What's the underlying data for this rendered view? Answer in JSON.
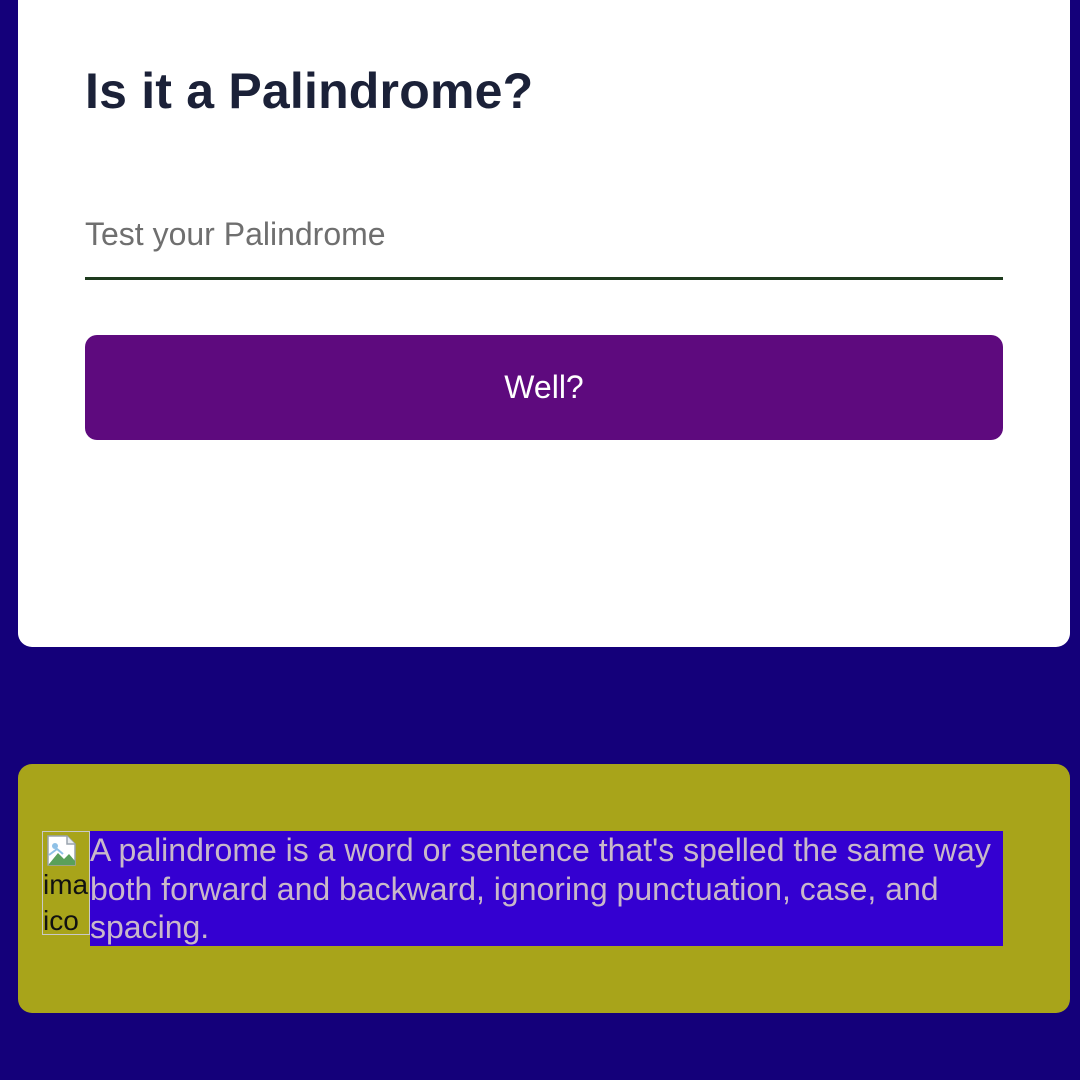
{
  "app": {
    "title": "Is it a Palindrome?"
  },
  "form": {
    "input_value": "",
    "input_placeholder": "Test your Palindrome",
    "submit_label": "Well?"
  },
  "info": {
    "image_alt_line1": "ima",
    "image_alt_line2": "ico",
    "description": "A palindrome is a word or sentence that's spelled the same way both forward and backward, ignoring punctuation, case, and spacing."
  },
  "colors": {
    "page_background": "#14007a",
    "card_background": "#ffffff",
    "button": "#5e0a7e",
    "info_panel": "#a8a41a",
    "description_highlight": "#3400d1"
  },
  "icons": {
    "broken_image": "broken-image-icon"
  }
}
